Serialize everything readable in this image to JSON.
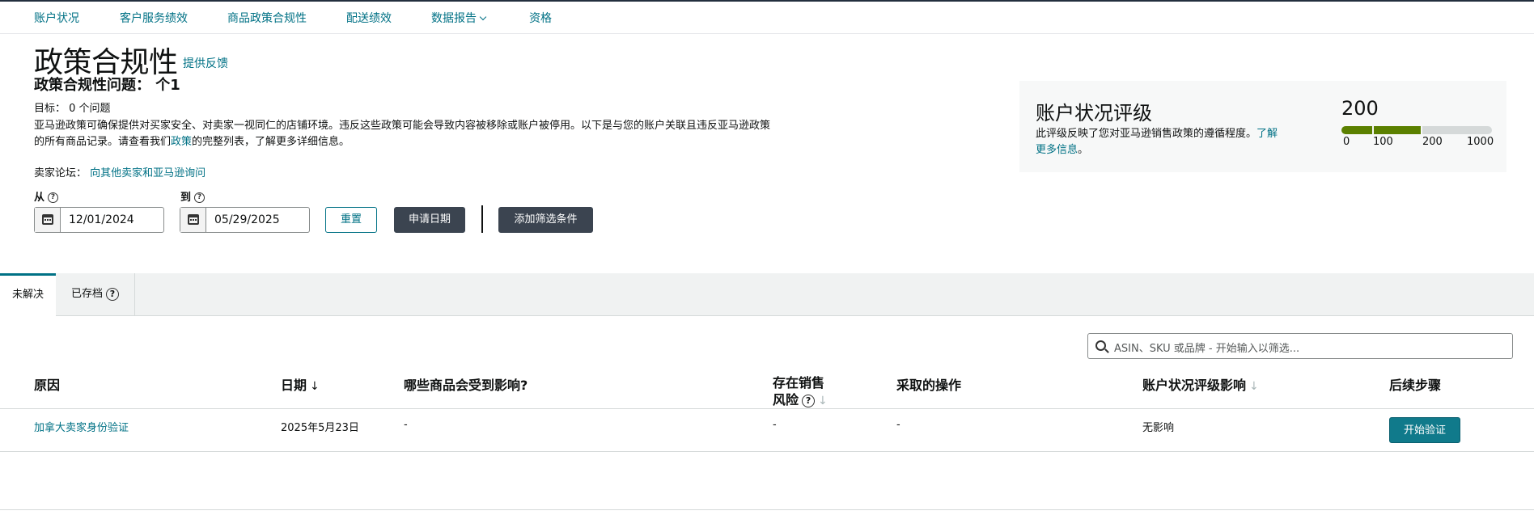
{
  "nav": {
    "items": [
      "账户状况",
      "客户服务绩效",
      "商品政策合规性",
      "配送绩效",
      "数据报告",
      "资格"
    ]
  },
  "page": {
    "title": "政策合规性",
    "feedback_link": "提供反馈",
    "issues_label": "政策合规性问题：",
    "issues_count": "个1",
    "target_label": "目标：",
    "target_value": "0 个问题",
    "desc_part1": "亚马逊政策可确保提供对买家安全、对卖家一视同仁的店铺环境。违反这些政策可能会导致内容被移除或账户被停用。以下是与您的账户关联且违反亚马逊政策的所有商品记录。请查看我们",
    "desc_link": "政策",
    "desc_part2": "的完整列表，了解更多详细信息。",
    "forum_label": "卖家论坛：",
    "forum_link": "向其他卖家和亚马逊询问"
  },
  "filters": {
    "from_label": "从",
    "to_label": "到",
    "from_date": "12/01/2024",
    "to_date": "05/29/2025",
    "reset_label": "重置",
    "apply_label": "申请日期",
    "add_filter_label": "添加筛选条件"
  },
  "health_card": {
    "title": "账户状况评级",
    "desc_part1": "此评级反映了您对亚马逊销售政策的遵循程度。",
    "learn_more": "了解更多信息",
    "desc_end": "。",
    "score": "200",
    "scale": {
      "min": 0,
      "max": 1000,
      "value": 200
    },
    "ticks": [
      "0",
      "100",
      "200",
      "1000"
    ],
    "colors": {
      "good": "#5b8000",
      "empty": "#d5d9d9"
    }
  },
  "tabs": {
    "unresolved": "未解决",
    "archived": "已存档"
  },
  "search": {
    "placeholder": "ASIN、SKU 或品牌 - 开始输入以筛选..."
  },
  "table": {
    "headers": {
      "reason": "原因",
      "date": "日期",
      "affected": "哪些商品会受到影响?",
      "risk_line1": "存在销售",
      "risk_line2": "风险",
      "action": "采取的操作",
      "impact": "账户状况评级影响",
      "next": "后续步骤"
    },
    "rows": [
      {
        "reason": "加拿大卖家身份验证",
        "date": "2025年5月23日",
        "affected": "-",
        "risk": "-",
        "action": "-",
        "impact": "无影响",
        "next": "开始验证"
      }
    ]
  }
}
